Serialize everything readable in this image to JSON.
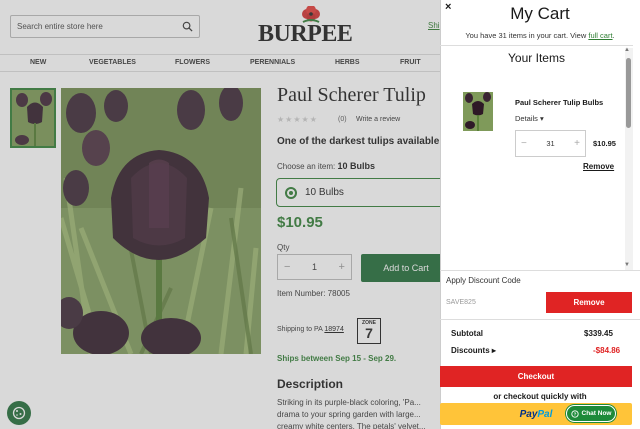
{
  "header": {
    "search_placeholder": "Search entire store here",
    "logo_text": "BURPEE",
    "ship_link": "Shi"
  },
  "nav": [
    "NEW",
    "VEGETABLES",
    "FLOWERS",
    "PERENNIALS",
    "HERBS",
    "FRUIT"
  ],
  "product": {
    "title": "Paul Scherer Tulip",
    "review_count": "(0)",
    "write_review": "Write a review",
    "tagline": "One of the darkest tulips available!",
    "choose_label": "Choose an item:",
    "choose_value": "10 Bulbs",
    "option_label": "10 Bulbs",
    "price": "$10.95",
    "qty_label": "Qty",
    "qty_value": "1",
    "add_to_cart": "Add to Cart",
    "item_number": "Item Number: 78005",
    "shipping_to": "Shipping to",
    "shipping_state": "PA",
    "shipping_zip": "18974",
    "zone_label": "ZONE",
    "zone_value": "7",
    "ships_between": "Ships between Sep 15 - Sep 29.",
    "description_heading": "Description",
    "description": "Striking in its purple-black coloring, 'Pa... drama to your spring garden with large... creamy white centers. The petals' velvet..."
  },
  "cart": {
    "close": "×",
    "title": "My Cart",
    "subtitle_prefix": "You have 31 items in your cart. View",
    "full_cart_link": "full cart",
    "subtitle_suffix": ".",
    "your_items": "Your Items",
    "item": {
      "name": "Paul Scherer Tulip Bulbs",
      "details": "Details",
      "qty": "31",
      "price": "$10.95",
      "remove": "Remove"
    },
    "discount_label": "Apply Discount Code",
    "discount_code": "SAVE825",
    "discount_button": "Remove",
    "subtotal_label": "Subtotal",
    "subtotal_value": "$339.45",
    "discounts_label": "Discounts",
    "discounts_value": "-$84.86",
    "checkout": "Checkout",
    "or_checkout": "or checkout quickly with",
    "paypal_1": "Pay",
    "paypal_2": "Pal",
    "chat_now": "Chat Now"
  },
  "colors": {
    "brand_green": "#2e7d32",
    "button_green": "#1e6b35",
    "cart_red": "#e02424",
    "paypal_yellow": "#ffc439"
  }
}
